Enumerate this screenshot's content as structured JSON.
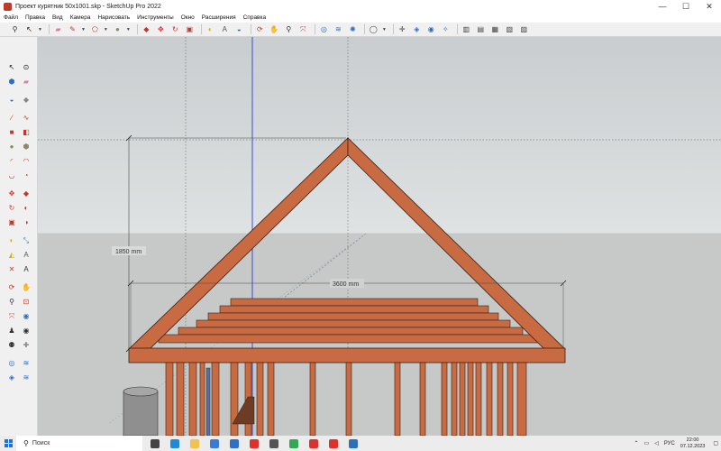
{
  "window": {
    "title": "Проект курятник 50х1001.skp - SketchUp Pro 2022",
    "controls": [
      "—",
      "☐",
      "✕"
    ]
  },
  "menu": [
    "Файл",
    "Правка",
    "Вид",
    "Камера",
    "Нарисовать",
    "Инструменты",
    "Окно",
    "Расширения",
    "Справка"
  ],
  "toolbar": {
    "icons": [
      {
        "name": "search-icon",
        "glyph": "⚲",
        "color": "#2b2b2b"
      },
      {
        "name": "select-arrow-icon",
        "glyph": "↖",
        "color": "#111111",
        "dropdown": true
      },
      {
        "name": "eraser-icon",
        "glyph": "▰",
        "color": "#e07b9b"
      },
      {
        "name": "pencil-icon",
        "glyph": "✎",
        "color": "#c0392b",
        "dropdown": true
      },
      {
        "name": "shape-icon",
        "glyph": "⬠",
        "color": "#c0392b",
        "dropdown": true
      },
      {
        "name": "circle-icon",
        "glyph": "●",
        "color": "#8a8a6a",
        "dropdown": true
      },
      {
        "name": "push-pull-icon",
        "glyph": "◆",
        "color": "#c0392b"
      },
      {
        "name": "move-icon",
        "glyph": "✥",
        "color": "#d63031"
      },
      {
        "name": "rotate-icon",
        "glyph": "↻",
        "color": "#d63031"
      },
      {
        "name": "scale-icon",
        "glyph": "▣",
        "color": "#c0392b"
      },
      {
        "name": "tape-measure-icon",
        "glyph": "◐",
        "color": "#d4ac0d"
      },
      {
        "name": "text-icon",
        "glyph": "A",
        "color": "#555555"
      },
      {
        "name": "paint-bucket-icon",
        "glyph": "◒",
        "color": "#2c6fbb"
      },
      {
        "name": "orbit-icon",
        "glyph": "⟳",
        "color": "#c0392b"
      },
      {
        "name": "pan-icon",
        "glyph": "✋",
        "color": "#d4a017"
      },
      {
        "name": "zoom-icon",
        "glyph": "⚲",
        "color": "#2b2b2b"
      },
      {
        "name": "zoom-extents-icon",
        "glyph": "⤧",
        "color": "#d63031"
      },
      {
        "name": "warehouse-icon",
        "glyph": "◎",
        "color": "#2c6fbb"
      },
      {
        "name": "extension-warehouse-icon",
        "glyph": "≋",
        "color": "#2c6fbb"
      },
      {
        "name": "layout-icon",
        "glyph": "✺",
        "color": "#2c6fbb"
      },
      {
        "name": "account-icon",
        "glyph": "◯",
        "color": "#444444",
        "dropdown": true
      },
      {
        "name": "axes-icon",
        "glyph": "✛",
        "color": "#2b2b2b"
      },
      {
        "name": "view-iso-icon",
        "glyph": "◈",
        "color": "#2c6fbb"
      },
      {
        "name": "view-front-icon",
        "glyph": "◉",
        "color": "#2c6fbb"
      },
      {
        "name": "view-right-icon",
        "glyph": "✧",
        "color": "#2c6fbb"
      },
      {
        "name": "style-xray-icon",
        "glyph": "▥",
        "color": "#444444"
      },
      {
        "name": "style-wireframe-icon",
        "glyph": "▤",
        "color": "#444444"
      },
      {
        "name": "style-hidden-icon",
        "glyph": "▦",
        "color": "#444444"
      },
      {
        "name": "style-shaded-icon",
        "glyph": "▧",
        "color": "#444444"
      },
      {
        "name": "style-textured-icon",
        "glyph": "▨",
        "color": "#444444"
      }
    ]
  },
  "lefttools": [
    {
      "name": "select-tool-icon",
      "glyph": "↖",
      "color": "#111111"
    },
    {
      "name": "lasso-tool-icon",
      "glyph": "⊙",
      "color": "#111111"
    },
    {
      "name": "component-tool-icon",
      "glyph": "⬢",
      "color": "#2c6fbb"
    },
    {
      "name": "eraser-tool-icon",
      "glyph": "▰",
      "color": "#e07b9b"
    },
    {
      "name": "paint-tool-icon",
      "glyph": "◒",
      "color": "#2c6fbb"
    },
    {
      "name": "tag-tool-icon",
      "glyph": "◆",
      "color": "#888888"
    },
    {
      "name": "line-tool-icon",
      "glyph": "∕",
      "color": "#c0392b"
    },
    {
      "name": "freehand-tool-icon",
      "glyph": "∿",
      "color": "#c0392b"
    },
    {
      "name": "rectangle-tool-icon",
      "glyph": "■",
      "color": "#c0392b"
    },
    {
      "name": "rotated-rect-tool-icon",
      "glyph": "◧",
      "color": "#c0392b"
    },
    {
      "name": "circle-tool-icon",
      "glyph": "●",
      "color": "#8a8a6a"
    },
    {
      "name": "polygon-tool-icon",
      "glyph": "⬢",
      "color": "#8a8a6a"
    },
    {
      "name": "arc-tool-icon",
      "glyph": "◜",
      "color": "#c0392b"
    },
    {
      "name": "arc2-tool-icon",
      "glyph": "◠",
      "color": "#c0392b"
    },
    {
      "name": "arc3-tool-icon",
      "glyph": "◡",
      "color": "#c0392b"
    },
    {
      "name": "pie-tool-icon",
      "glyph": "◔",
      "color": "#c0392b"
    },
    {
      "name": "move-tool-icon",
      "glyph": "✥",
      "color": "#d63031"
    },
    {
      "name": "push-pull-tool-icon",
      "glyph": "◆",
      "color": "#c0392b"
    },
    {
      "name": "rotate-tool-icon",
      "glyph": "↻",
      "color": "#d63031"
    },
    {
      "name": "follow-me-tool-icon",
      "glyph": "◐",
      "color": "#c0392b"
    },
    {
      "name": "scale-tool-icon",
      "glyph": "▣",
      "color": "#c0392b"
    },
    {
      "name": "offset-tool-icon",
      "glyph": "◑",
      "color": "#c0392b"
    },
    {
      "name": "tape-tool-icon",
      "glyph": "◐",
      "color": "#d4ac0d"
    },
    {
      "name": "dimension-tool-icon",
      "glyph": "⤡",
      "color": "#2c6fbb"
    },
    {
      "name": "protractor-tool-icon",
      "glyph": "◭",
      "color": "#d4ac0d"
    },
    {
      "name": "text-tool-icon",
      "glyph": "A",
      "color": "#555555"
    },
    {
      "name": "axes-tool-icon",
      "glyph": "✕",
      "color": "#d63031"
    },
    {
      "name": "3dtext-tool-icon",
      "glyph": "A",
      "color": "#333333"
    },
    {
      "name": "orbit-tool-icon",
      "glyph": "⟳",
      "color": "#c0392b"
    },
    {
      "name": "pan-tool-icon",
      "glyph": "✋",
      "color": "#d4a017"
    },
    {
      "name": "zoom-tool-icon",
      "glyph": "⚲",
      "color": "#2b2b2b"
    },
    {
      "name": "zoom-window-tool-icon",
      "glyph": "⊡",
      "color": "#c0392b"
    },
    {
      "name": "zoom-extents-tool-icon",
      "glyph": "⤧",
      "color": "#d63031"
    },
    {
      "name": "prev-view-tool-icon",
      "glyph": "◉",
      "color": "#2c6fbb"
    },
    {
      "name": "position-camera-tool-icon",
      "glyph": "♟",
      "color": "#333333"
    },
    {
      "name": "look-around-tool-icon",
      "glyph": "◉",
      "color": "#333333"
    },
    {
      "name": "walk-tool-icon",
      "glyph": "⚉",
      "color": "#333333"
    },
    {
      "name": "section-tool-icon",
      "glyph": "✛",
      "color": "#333333"
    },
    {
      "name": "warehouse-tool-icon",
      "glyph": "◎",
      "color": "#2c6fbb"
    },
    {
      "name": "extension-tool-icon",
      "glyph": "≋",
      "color": "#2c6fbb"
    },
    {
      "name": "share-tool-icon",
      "glyph": "◈",
      "color": "#2c6fbb"
    },
    {
      "name": "layout-tool-icon",
      "glyph": "≋",
      "color": "#2c6fbb"
    }
  ],
  "model": {
    "dimension_height": "1850 mm",
    "dimension_width": "3600 mm",
    "colors": {
      "sky": "#d4d8d9",
      "ground": "#c7cac8",
      "wood": "#c86b43",
      "wood_edge": "#3a1e12"
    }
  },
  "taskbar": {
    "search_label": "Поиск",
    "apps": [
      {
        "name": "task-view-icon",
        "color": "#444444"
      },
      {
        "name": "edge-icon",
        "color": "#1f8ad8"
      },
      {
        "name": "file-explorer-icon",
        "color": "#f2c14e"
      },
      {
        "name": "store-icon",
        "color": "#3a7bd5"
      },
      {
        "name": "mail-icon",
        "color": "#2f6fc6"
      },
      {
        "name": "opera-icon",
        "color": "#e0302c"
      },
      {
        "name": "game-icon",
        "color": "#555555"
      },
      {
        "name": "chrome-icon",
        "color": "#34a853"
      },
      {
        "name": "yandex-browser-icon",
        "color": "#e0302c"
      },
      {
        "name": "yandex-icon",
        "color": "#e0302c"
      },
      {
        "name": "sketchup-icon",
        "color": "#2c6fbb"
      }
    ],
    "lang": "РУС",
    "time": "22:00",
    "date": "07.12.2023"
  }
}
